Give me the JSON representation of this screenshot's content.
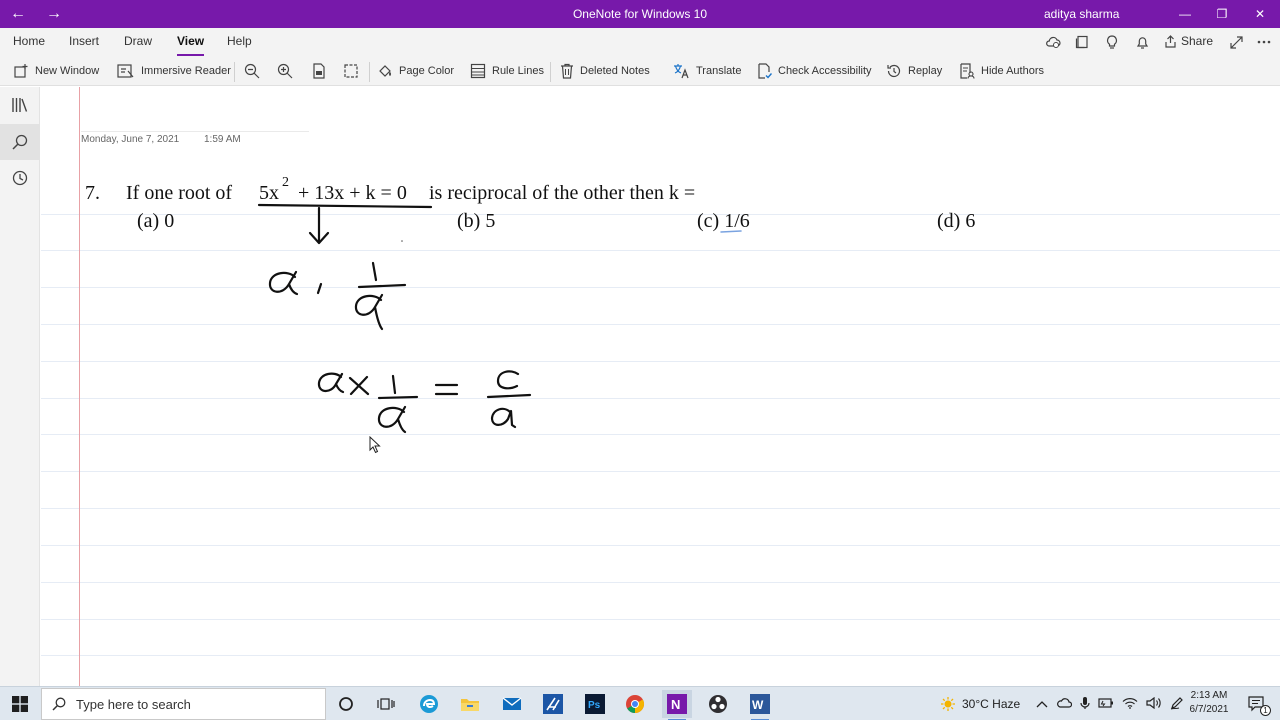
{
  "window": {
    "title": "OneNote for Windows 10",
    "user": "aditya sharma",
    "back_glyph": "←",
    "forward_glyph": "→",
    "minimize_glyph": "—",
    "restore_glyph": "❐",
    "close_glyph": "✕"
  },
  "tabs": [
    "Home",
    "Insert",
    "Draw",
    "View",
    "Help"
  ],
  "active_tab": "View",
  "share_label": "Share",
  "ribbon": {
    "new_window": "New Window",
    "immersive_reader": "Immersive Reader",
    "page_color": "Page Color",
    "rule_lines": "Rule Lines",
    "deleted_notes": "Deleted Notes",
    "translate": "Translate",
    "check_accessibility": "Check Accessibility",
    "replay": "Replay",
    "hide_authors": "Hide Authors"
  },
  "page": {
    "date": "Monday, June 7, 2021",
    "time": "1:59 AM",
    "question": {
      "number": "7.",
      "prefix": "If one root of",
      "equation_base": "5x",
      "exponent": "2",
      "equation_rest": "+ 13x + k = 0",
      "suffix": "is reciprocal of the other then k ="
    },
    "options": {
      "a": "(a) 0",
      "b": "(b) 5",
      "c": "(c)  1/6",
      "d": "(d) 6"
    }
  },
  "taskbar": {
    "search_placeholder": "Type here to search",
    "weather": "30°C  Haze",
    "time": "2:13 AM",
    "date": "6/7/2021",
    "notification_count": "1"
  },
  "colors": {
    "accent": "#7719aa",
    "margin_line": "#e8a1a6",
    "rule_line": "#e6ecf5"
  }
}
